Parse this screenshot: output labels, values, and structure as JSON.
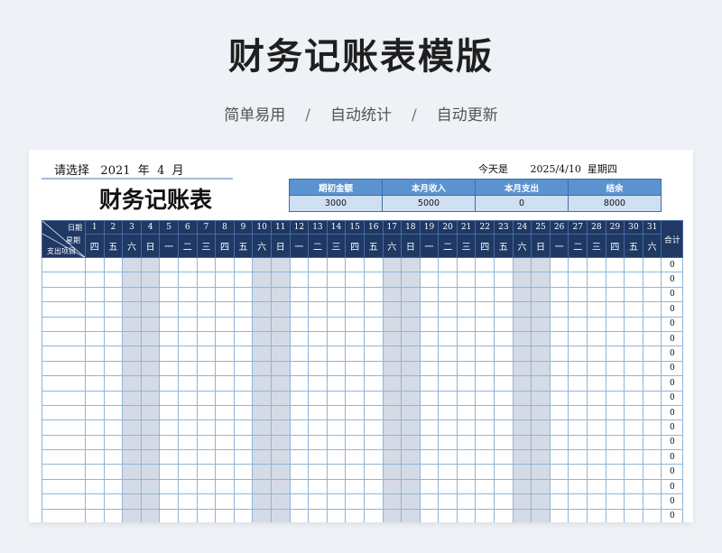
{
  "header": {
    "title": "财务记账表模版",
    "tags": [
      "简单易用",
      "自动统计",
      "自动更新"
    ],
    "separator": "/"
  },
  "sheet": {
    "select_label": "请选择",
    "year": "2021",
    "year_unit": "年",
    "month": "4",
    "month_unit": "月",
    "today_label": "今天是",
    "today_date": "2025/4/10",
    "today_weekday": "星期四",
    "ledger_title": "财务记账表",
    "summary": {
      "headers": [
        "期初金额",
        "本月收入",
        "本月支出",
        "结余"
      ],
      "values": [
        "3000",
        "5000",
        "0",
        "8000"
      ]
    },
    "grid": {
      "corner_date": "日期",
      "corner_week": "星期",
      "corner_item": "支出项目",
      "total_label": "合计",
      "days": [
        "1",
        "2",
        "3",
        "4",
        "5",
        "6",
        "7",
        "8",
        "9",
        "10",
        "11",
        "12",
        "13",
        "14",
        "15",
        "16",
        "17",
        "18",
        "19",
        "20",
        "21",
        "22",
        "23",
        "24",
        "25",
        "26",
        "27",
        "28",
        "29",
        "30",
        "31"
      ],
      "weekdays": [
        "四",
        "五",
        "六",
        "日",
        "一",
        "二",
        "三",
        "四",
        "五",
        "六",
        "日",
        "一",
        "二",
        "三",
        "四",
        "五",
        "六",
        "日",
        "一",
        "二",
        "三",
        "四",
        "五",
        "六",
        "日",
        "一",
        "二",
        "三",
        "四",
        "五",
        "六"
      ],
      "weekend_flags": [
        false,
        false,
        true,
        true,
        false,
        false,
        false,
        false,
        false,
        true,
        true,
        false,
        false,
        false,
        false,
        false,
        true,
        true,
        false,
        false,
        false,
        false,
        false,
        true,
        true,
        false,
        false,
        false,
        false,
        false,
        false
      ],
      "totals": [
        "0",
        "0",
        "0",
        "0",
        "0",
        "0",
        "0",
        "0",
        "0",
        "0",
        "0",
        "0",
        "0",
        "0",
        "0",
        "0",
        "0",
        "0"
      ]
    },
    "colors": {
      "header_bg": "#1f3864",
      "summary_header_bg": "#5b93d0",
      "summary_value_bg": "#cfe0f2",
      "weekend_bg": "#d4dbe6",
      "grid_line": "#8fb5d6"
    }
  }
}
